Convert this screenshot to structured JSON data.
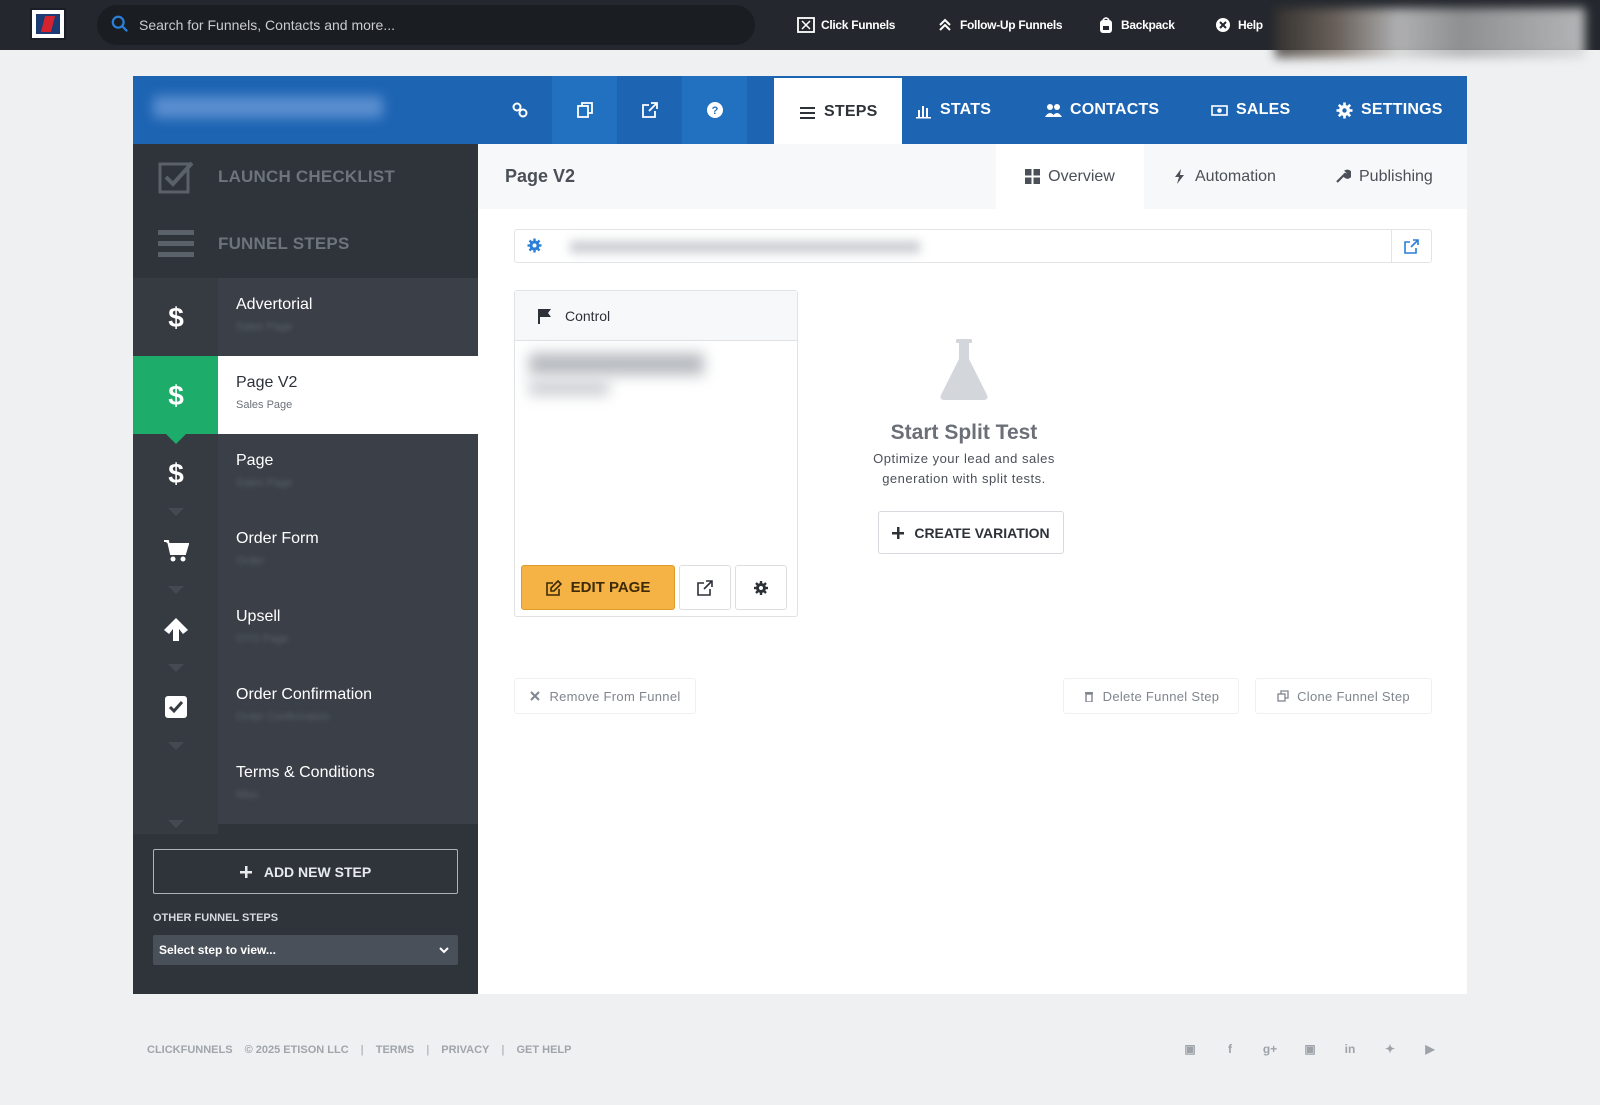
{
  "topbar": {
    "search_placeholder": "Search for Funnels, Contacts and more...",
    "nav": [
      "Click Funnels",
      "Follow-Up Funnels",
      "Backpack",
      "Help"
    ]
  },
  "header": {
    "tabs": [
      {
        "label": "STEPS",
        "icon": "list-icon",
        "active": true
      },
      {
        "label": "STATS",
        "icon": "bar-chart-icon",
        "active": false
      },
      {
        "label": "CONTACTS",
        "icon": "users-icon",
        "active": false
      },
      {
        "label": "SALES",
        "icon": "money-icon",
        "active": false
      },
      {
        "label": "SETTINGS",
        "icon": "gear-icon",
        "active": false
      }
    ],
    "tool_icons": [
      "link-icon",
      "copy-icon",
      "external-link-icon",
      "help-icon"
    ]
  },
  "sidebar": {
    "launch_checklist": "LAUNCH CHECKLIST",
    "funnel_steps": "FUNNEL STEPS",
    "steps": [
      {
        "title": "Advertorial",
        "subtitle": "Sales Page",
        "icon": "dollar-icon",
        "active": false
      },
      {
        "title": "Page V2",
        "subtitle": "Sales Page",
        "icon": "dollar-icon",
        "active": true
      },
      {
        "title": "Page",
        "subtitle": "Sales Page",
        "icon": "dollar-icon",
        "active": false
      },
      {
        "title": "Order Form",
        "subtitle": "Order",
        "icon": "cart-icon",
        "active": false
      },
      {
        "title": "Upsell",
        "subtitle": "OTO Page",
        "icon": "arrow-up-icon",
        "active": false
      },
      {
        "title": "Order Confirmation",
        "subtitle": "Order Confirmation",
        "icon": "checkbox-icon",
        "active": false
      },
      {
        "title": "Terms & Conditions",
        "subtitle": "Misc",
        "icon": "none",
        "active": false
      }
    ],
    "add_step": "ADD NEW STEP",
    "other_label": "OTHER FUNNEL STEPS",
    "other_select": "Select step to view..."
  },
  "main": {
    "page_title": "Page V2",
    "subtabs": [
      "Overview",
      "Automation",
      "Publishing"
    ],
    "control_label": "Control",
    "edit_page": "EDIT PAGE",
    "split_title": "Start Split Test",
    "split_desc_1": "Optimize your lead and sales",
    "split_desc_2": "generation with split tests.",
    "create_variation": "CREATE VARIATION",
    "remove": "Remove From Funnel",
    "delete": "Delete Funnel Step",
    "clone": "Clone Funnel Step"
  },
  "footer": {
    "brand": "CLICKFUNNELS",
    "copyright": "© 2025 ETISON LLC",
    "links": [
      "TERMS",
      "PRIVACY",
      "GET HELP"
    ],
    "social_icons": [
      "rss-icon",
      "facebook-icon",
      "google-plus-icon",
      "instagram-icon",
      "linkedin-icon",
      "twitter-icon",
      "youtube-icon"
    ]
  },
  "colors": {
    "header_blue": "#1d64b3",
    "active_green": "#1eac6a",
    "edit_orange": "#f5b345",
    "sidebar_dark": "#2f343b"
  }
}
